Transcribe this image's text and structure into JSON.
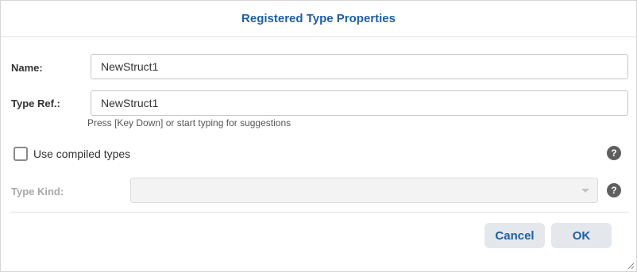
{
  "dialog": {
    "title": "Registered Type Properties"
  },
  "form": {
    "name_label": "Name:",
    "name_value": "NewStruct1",
    "type_ref_label": "Type Ref.:",
    "type_ref_value": "NewStruct1",
    "type_ref_hint": "Press [Key Down] or start typing for suggestions",
    "compiled_types_label": "Use compiled types",
    "compiled_types_checked": false,
    "type_kind_label": "Type Kind:",
    "type_kind_value": "",
    "help_glyph": "?"
  },
  "buttons": {
    "cancel_label": "Cancel",
    "ok_label": "OK"
  },
  "icons": {
    "help": "question-circle-icon",
    "dropdown": "chevron-down-icon",
    "resize": "resize-grip-icon"
  },
  "colors": {
    "accent": "#1f5fa5",
    "button_bg": "#e4e7ec",
    "help_icon_bg": "#5f5f5f",
    "disabled_text": "#a8a8a8"
  }
}
